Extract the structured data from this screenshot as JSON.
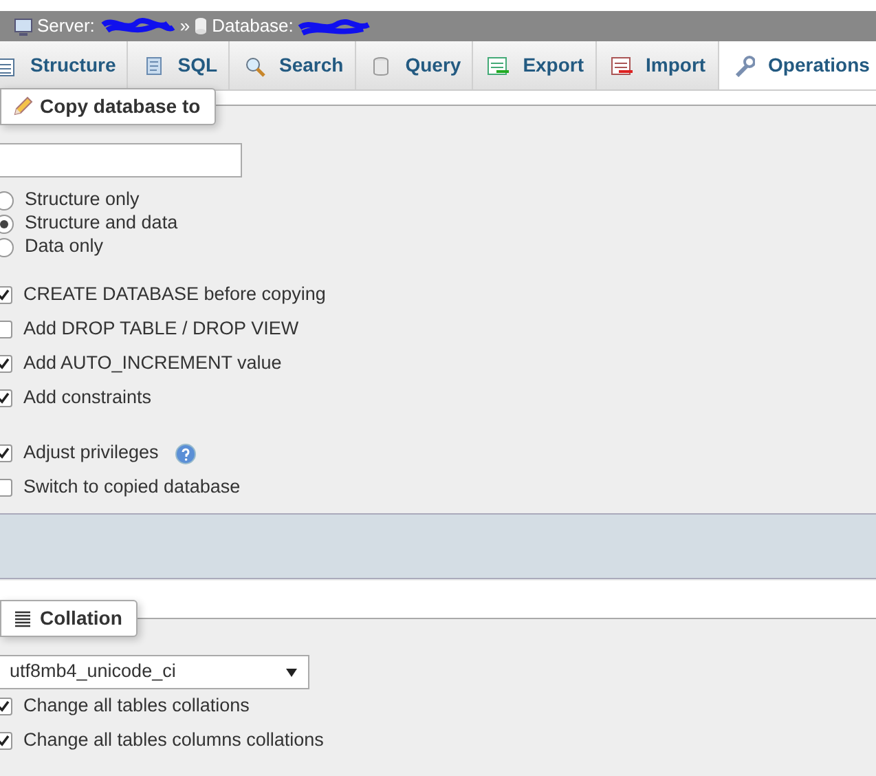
{
  "breadcrumb": {
    "server_label": "Server:",
    "separator": "»",
    "database_label": "Database:"
  },
  "tabs": [
    {
      "label": "Structure",
      "kind": "structure",
      "selected": false
    },
    {
      "label": "SQL",
      "kind": "sql",
      "selected": false
    },
    {
      "label": "Search",
      "kind": "search",
      "selected": false
    },
    {
      "label": "Query",
      "kind": "query",
      "selected": false
    },
    {
      "label": "Export",
      "kind": "export",
      "selected": false
    },
    {
      "label": "Import",
      "kind": "import",
      "selected": false
    },
    {
      "label": "Operations",
      "kind": "operations",
      "selected": true
    }
  ],
  "copy_section": {
    "legend": "Copy database to",
    "modes": [
      {
        "label": "Structure only",
        "selected": false
      },
      {
        "label": "Structure and data",
        "selected": true
      },
      {
        "label": "Data only",
        "selected": false
      }
    ],
    "option_groups": [
      [
        {
          "label": "CREATE DATABASE before copying",
          "checked": true
        },
        {
          "label": "Add DROP TABLE / DROP VIEW",
          "checked": false
        },
        {
          "label": "Add AUTO_INCREMENT value",
          "checked": true
        },
        {
          "label": "Add constraints",
          "checked": true
        }
      ],
      [
        {
          "label": "Adjust privileges",
          "checked": true,
          "help": true
        },
        {
          "label": "Switch to copied database",
          "checked": false
        }
      ]
    ]
  },
  "collation_section": {
    "legend": "Collation",
    "select_value": "utf8mb4_unicode_ci",
    "options": [
      {
        "label": "Change all tables collations",
        "checked": true
      },
      {
        "label": "Change all tables columns collations",
        "checked": true
      }
    ]
  }
}
